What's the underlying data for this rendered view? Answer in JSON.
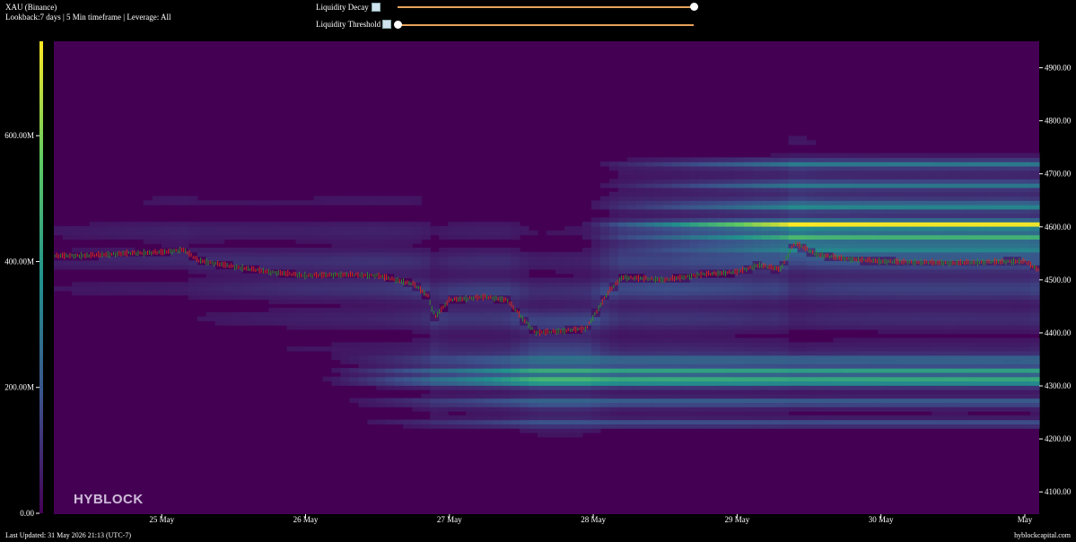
{
  "header": {
    "title": "XAU (Binance)",
    "subtitle": "Lookback:7 days | 5 Min timeframe | Leverage: All"
  },
  "controls": {
    "decay_label": "Liquidity Decay",
    "threshold_label": "Liquidity Threshold",
    "decay_value": 1.0,
    "threshold_value": 0.0
  },
  "footer": {
    "updated": "Last Updated: 31 May 2026 21:13 (UTC-7)",
    "site": "hyblockcapital.com"
  },
  "brand": "HYBLOCK",
  "colors": {
    "background": "#000000",
    "heat_low": "#440154",
    "heat_high": "#fde725",
    "price_up": "#2e8b2e",
    "price_down": "#d22a1e",
    "slider_track": "#e8a25a"
  },
  "chart_data": {
    "type": "heatmap",
    "x_ticks": [
      "25 May",
      "26 May",
      "27 May",
      "28 May",
      "29 May",
      "30 May",
      "May"
    ],
    "x_range_days": [
      24.25,
      31.1
    ],
    "y_ticks": [
      "4100.00",
      "4200.00",
      "4300.00",
      "4400.00",
      "4500.00",
      "4600.00",
      "4700.00",
      "4800.00",
      "4900.00"
    ],
    "ylim": [
      4058,
      4950
    ],
    "colorbar_ticks": [
      "0.00",
      "200.00M",
      "400.00M",
      "600.00M"
    ],
    "colorbar_range": [
      0,
      750
    ],
    "price_path": [
      [
        24.25,
        4545
      ],
      [
        24.5,
        4546
      ],
      [
        24.75,
        4550
      ],
      [
        25.0,
        4552
      ],
      [
        25.15,
        4557
      ],
      [
        25.25,
        4537
      ],
      [
        25.5,
        4525
      ],
      [
        25.75,
        4515
      ],
      [
        26.0,
        4508
      ],
      [
        26.25,
        4510
      ],
      [
        26.5,
        4508
      ],
      [
        26.75,
        4492
      ],
      [
        26.85,
        4470
      ],
      [
        26.9,
        4430
      ],
      [
        27.0,
        4462
      ],
      [
        27.25,
        4468
      ],
      [
        27.4,
        4462
      ],
      [
        27.5,
        4430
      ],
      [
        27.6,
        4400
      ],
      [
        27.75,
        4403
      ],
      [
        27.95,
        4408
      ],
      [
        28.0,
        4430
      ],
      [
        28.1,
        4475
      ],
      [
        28.2,
        4505
      ],
      [
        28.5,
        4500
      ],
      [
        28.75,
        4510
      ],
      [
        29.0,
        4515
      ],
      [
        29.15,
        4528
      ],
      [
        29.3,
        4520
      ],
      [
        29.4,
        4570
      ],
      [
        29.55,
        4548
      ],
      [
        29.75,
        4540
      ],
      [
        30.0,
        4535
      ],
      [
        30.5,
        4532
      ],
      [
        30.75,
        4534
      ],
      [
        31.0,
        4535
      ],
      [
        31.1,
        4518
      ]
    ],
    "liquidity_bands": [
      {
        "price": 4310,
        "intensity": 0.98
      },
      {
        "price": 4605,
        "intensity": 0.98
      },
      {
        "price": 4330,
        "intensity": 0.55
      },
      {
        "price": 4350,
        "intensity": 0.5
      },
      {
        "price": 4640,
        "intensity": 0.55
      },
      {
        "price": 4680,
        "intensity": 0.5
      },
      {
        "price": 4720,
        "intensity": 0.45
      },
      {
        "price": 4580,
        "intensity": 0.6
      },
      {
        "price": 4560,
        "intensity": 0.55
      },
      {
        "price": 4270,
        "intensity": 0.45
      },
      {
        "price": 4230,
        "intensity": 0.35
      }
    ]
  }
}
